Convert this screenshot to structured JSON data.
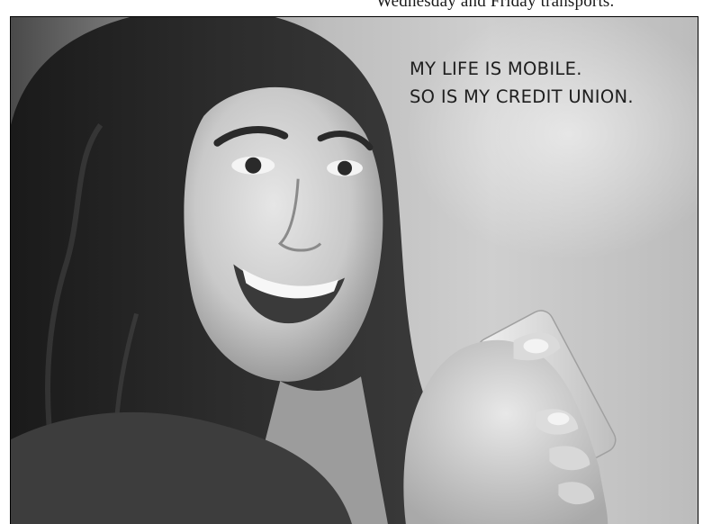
{
  "page": {
    "top_text": "Wednesday and Friday transports."
  },
  "ad": {
    "headline_line1": "MY LIFE IS MOBILE.",
    "headline_line2": "SO IS MY CREDIT UNION.",
    "colors": {
      "border": "#000000",
      "text": "#1e1e1e"
    }
  }
}
